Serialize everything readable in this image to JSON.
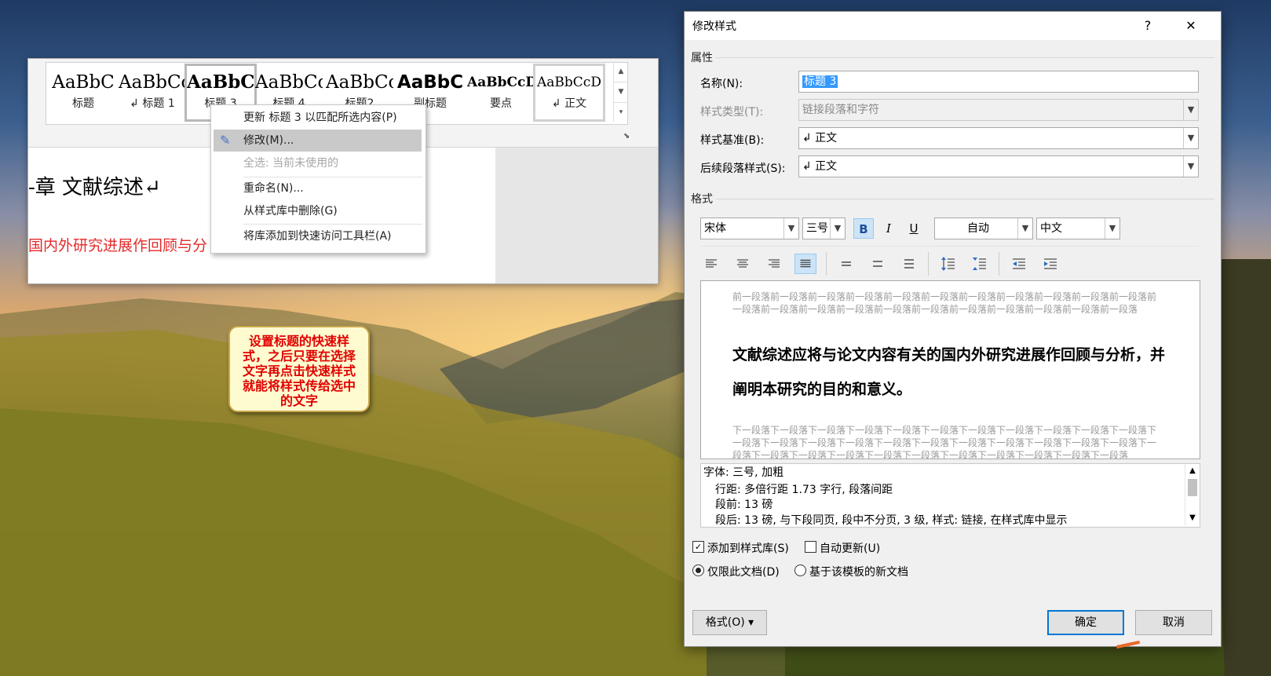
{
  "word": {
    "gallery": [
      {
        "preview": "AaBbC",
        "name": "标题",
        "selected": false
      },
      {
        "preview": "AaBbCc",
        "name": "↲ 标题 1",
        "selected": false
      },
      {
        "preview": "AaBbC",
        "name": "标题 3",
        "selected": true
      },
      {
        "preview": "AaBbCc",
        "name": "标题 4",
        "selected": false
      },
      {
        "preview": "AaBbCc",
        "name": "标题2",
        "selected": false
      },
      {
        "preview": "AaBbC",
        "name": "副标题",
        "selected": false
      },
      {
        "preview": "AaBbCcD",
        "name": "要点",
        "selected": false
      },
      {
        "preview": "AaBbCcD",
        "name": "↲ 正文",
        "selected": false
      }
    ],
    "doc_heading": "-章  文献综述↵",
    "doc_red_text": "国内外研究进展作回顾与分"
  },
  "context_menu": {
    "items": [
      {
        "label": "更新 标题 3 以匹配所选内容(P)",
        "state": "normal"
      },
      {
        "label": "修改(M)...",
        "state": "highlighted"
      },
      {
        "label": "全选: 当前未使用的",
        "state": "disabled"
      },
      {
        "label": "重命名(N)...",
        "state": "normal"
      },
      {
        "label": "从样式库中删除(G)",
        "state": "normal"
      },
      {
        "label": "将库添加到快速访问工具栏(A)",
        "state": "normal"
      }
    ]
  },
  "callout": {
    "text": "设置标题的快速样式，之后只要在选择文字再点击快速样式就能将样式传给选中的文字"
  },
  "dialog": {
    "title": "修改样式",
    "help_glyph": "?",
    "close_glyph": "✕",
    "properties_section": "属性",
    "name_label": "名称(N):",
    "name_value": "标题 3",
    "style_type_label": "样式类型(T):",
    "style_type_value": "链接段落和字符",
    "style_based_label": "样式基准(B):",
    "style_based_value": "↲ 正文",
    "following_label": "后续段落样式(S):",
    "following_value": "↲ 正文",
    "format_section": "格式",
    "font": "宋体",
    "size": "三号",
    "bold": "B",
    "italic": "I",
    "underline": "U",
    "color": "自动",
    "script": "中文",
    "preview_before": "前一段落前一段落前一段落前一段落前一段落前一段落前一段落前一段落前一段落前一段落前一段落前一段落前一段落前一段落前一段落前一段落前一段落前一段落前一段落前一段落前一段落前一段落",
    "preview_main": "文献综述应将与论文内容有关的国内外研究进展作回顾与分析，并阐明本研究的目的和意义。",
    "preview_after": "下一段落下一段落下一段落下一段落下一段落下一段落下一段落下一段落下一段落下一段落下一段落下一段落下一段落下一段落下一段落下一段落下一段落下一段落下一段落下一段落下一段落下一段落下一段落下一段落下一段落下一段落下一段落下一段落下一段落下一段落下一段落下一段落下一段落",
    "description": [
      "字体: 三号, 加粗",
      "行距: 多倍行距 1.73 字行, 段落间距",
      "段前: 13 磅",
      "段后: 13 磅, 与下段同页, 段中不分页, 3 级, 样式: 链接, 在样式库中显示"
    ],
    "add_to_gallery_label": "添加到样式库(S)",
    "add_to_gallery_checked": "✓",
    "auto_update_label": "自动更新(U)",
    "only_this_doc_label": "仅限此文档(D)",
    "new_docs_label": "基于该模板的新文档",
    "format_button": "格式(O) ▾",
    "ok_button": "确定",
    "cancel_button": "取消"
  }
}
